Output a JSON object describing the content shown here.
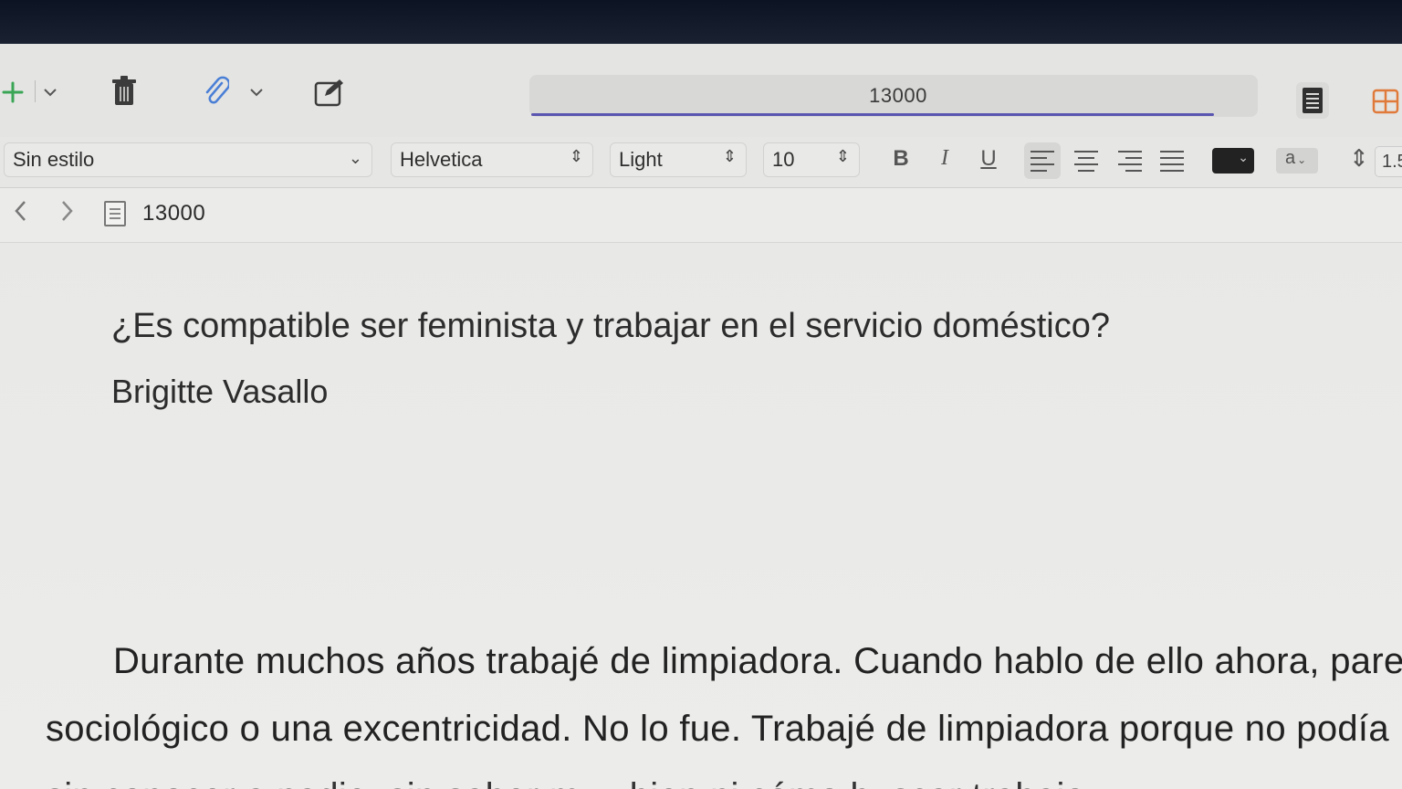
{
  "toolbar": {
    "add_icon": "plus-icon",
    "add_menu_icon": "chevron-down-icon",
    "delete_icon": "trash-icon",
    "attach_icon": "paperclip-icon",
    "attach_menu_icon": "chevron-down-icon",
    "compose_icon": "compose-icon",
    "note_title": "13000",
    "view_list_icon": "list-view-icon",
    "view_grid_icon": "grid-view-icon",
    "accent_color": "#5a55b0",
    "add_color": "#3aa655",
    "attach_color": "#4a7fd6",
    "grid_color": "#e07a3a"
  },
  "format": {
    "style": "Sin estilo",
    "font": "Helvetica",
    "weight": "Light",
    "size": "10",
    "bold": "B",
    "italic": "I",
    "underline": "U",
    "text_color": "#222222",
    "highlight_label": "a",
    "line_spacing": "1.5"
  },
  "nav": {
    "back_icon": "chevron-left-icon",
    "forward_icon": "chevron-right-icon",
    "doc_icon": "document-icon",
    "title": "13000"
  },
  "document": {
    "title": "¿Es compatible ser feminista y trabajar en el servicio doméstico?",
    "author": "Brigitte Vasallo",
    "paragraph_lines": [
      "Durante muchos años trabajé de limpiadora. Cuando hablo de ello ahora, pare",
      "sociológico o una excentricidad. No lo fue. Trabajé de limpiadora porque no podía",
      "sin conocer a nadie, sin saber muy bien ni cómo buscar trabajo"
    ]
  }
}
